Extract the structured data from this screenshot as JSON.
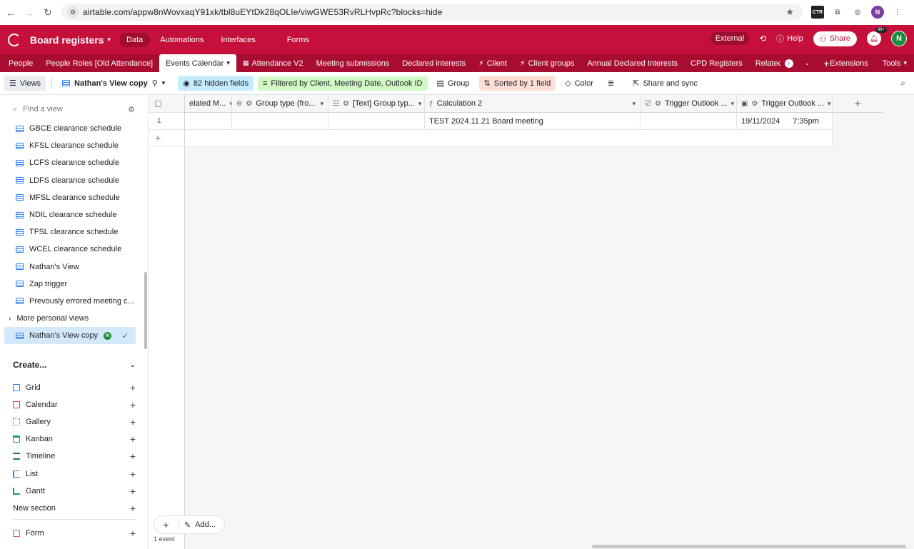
{
  "browser": {
    "url": "airtable.com/appw8nWovxaqY91xk/tbl8uEYtDk28qOLIe/viwGWE53RvRLHvpRc?blocks=hide",
    "profile_initial": "N"
  },
  "app": {
    "base_name": "Board registers",
    "nav": [
      "Data",
      "Automations",
      "Interfaces",
      "Forms"
    ],
    "external_label": "External",
    "help_label": "Help",
    "share_label": "Share",
    "notif_badge": "99+",
    "avatar_initial": "N"
  },
  "tables": {
    "tabs": [
      "People",
      "People Roles [Old Attendance]",
      "Events Calendar",
      "Attendance V2",
      "Meeting submissions",
      "Declared interests",
      "Client",
      "Client groups",
      "Annual Declared Interests",
      "CPD Registers",
      "Relatec"
    ],
    "extensions_label": "Extensions",
    "tools_label": "Tools"
  },
  "toolbar": {
    "views_label": "Views",
    "view_name": "Nathan's View copy",
    "hidden_fields": "82 hidden fields",
    "filter": "Filtered by Client, Meeting Date, Outlook ID",
    "group": "Group",
    "sort": "Sorted by 1 field",
    "color": "Color",
    "share_sync": "Share and sync"
  },
  "sidebar": {
    "find_placeholder": "Find a view",
    "views": [
      "GBCE clearance schedule",
      "KFSL clearance schedule",
      "LCFS clearance schedule",
      "LDFS clearance schedule",
      "MFSL clearance schedule",
      "NDIL clearance schedule",
      "TFSL clearance schedule",
      "WCEL clearance schedule",
      "Nathan's View",
      "Zap trigger",
      "Prevously errored meeting c..."
    ],
    "more_personal": "More personal views",
    "selected_view": "Nathan's View copy",
    "selected_badge": "N",
    "create_title": "Create...",
    "create_items": [
      "Grid",
      "Calendar",
      "Gallery",
      "Kanban",
      "Timeline",
      "List",
      "Gantt"
    ],
    "new_section": "New section",
    "form": "Form",
    "create_colors": [
      "#2d7ff9",
      "#e03c3c",
      "#8b46ff",
      "#11a35b",
      "#0f7a8a",
      "#2d7ff9",
      "#11a35b",
      "#d84ea0"
    ]
  },
  "grid": {
    "columns": [
      "elated M...",
      "Group type (fro...",
      "[Text] Group typ...",
      "Calculation 2",
      "Trigger Outlook ...",
      "Trigger Outlook ..."
    ],
    "row_number": "1",
    "calc_value": "TEST 2024.11.21 Board meeting",
    "date_value": "19/11/2024",
    "time_value": "7:35pm",
    "add_label": "Add...",
    "record_count": "1 event"
  }
}
